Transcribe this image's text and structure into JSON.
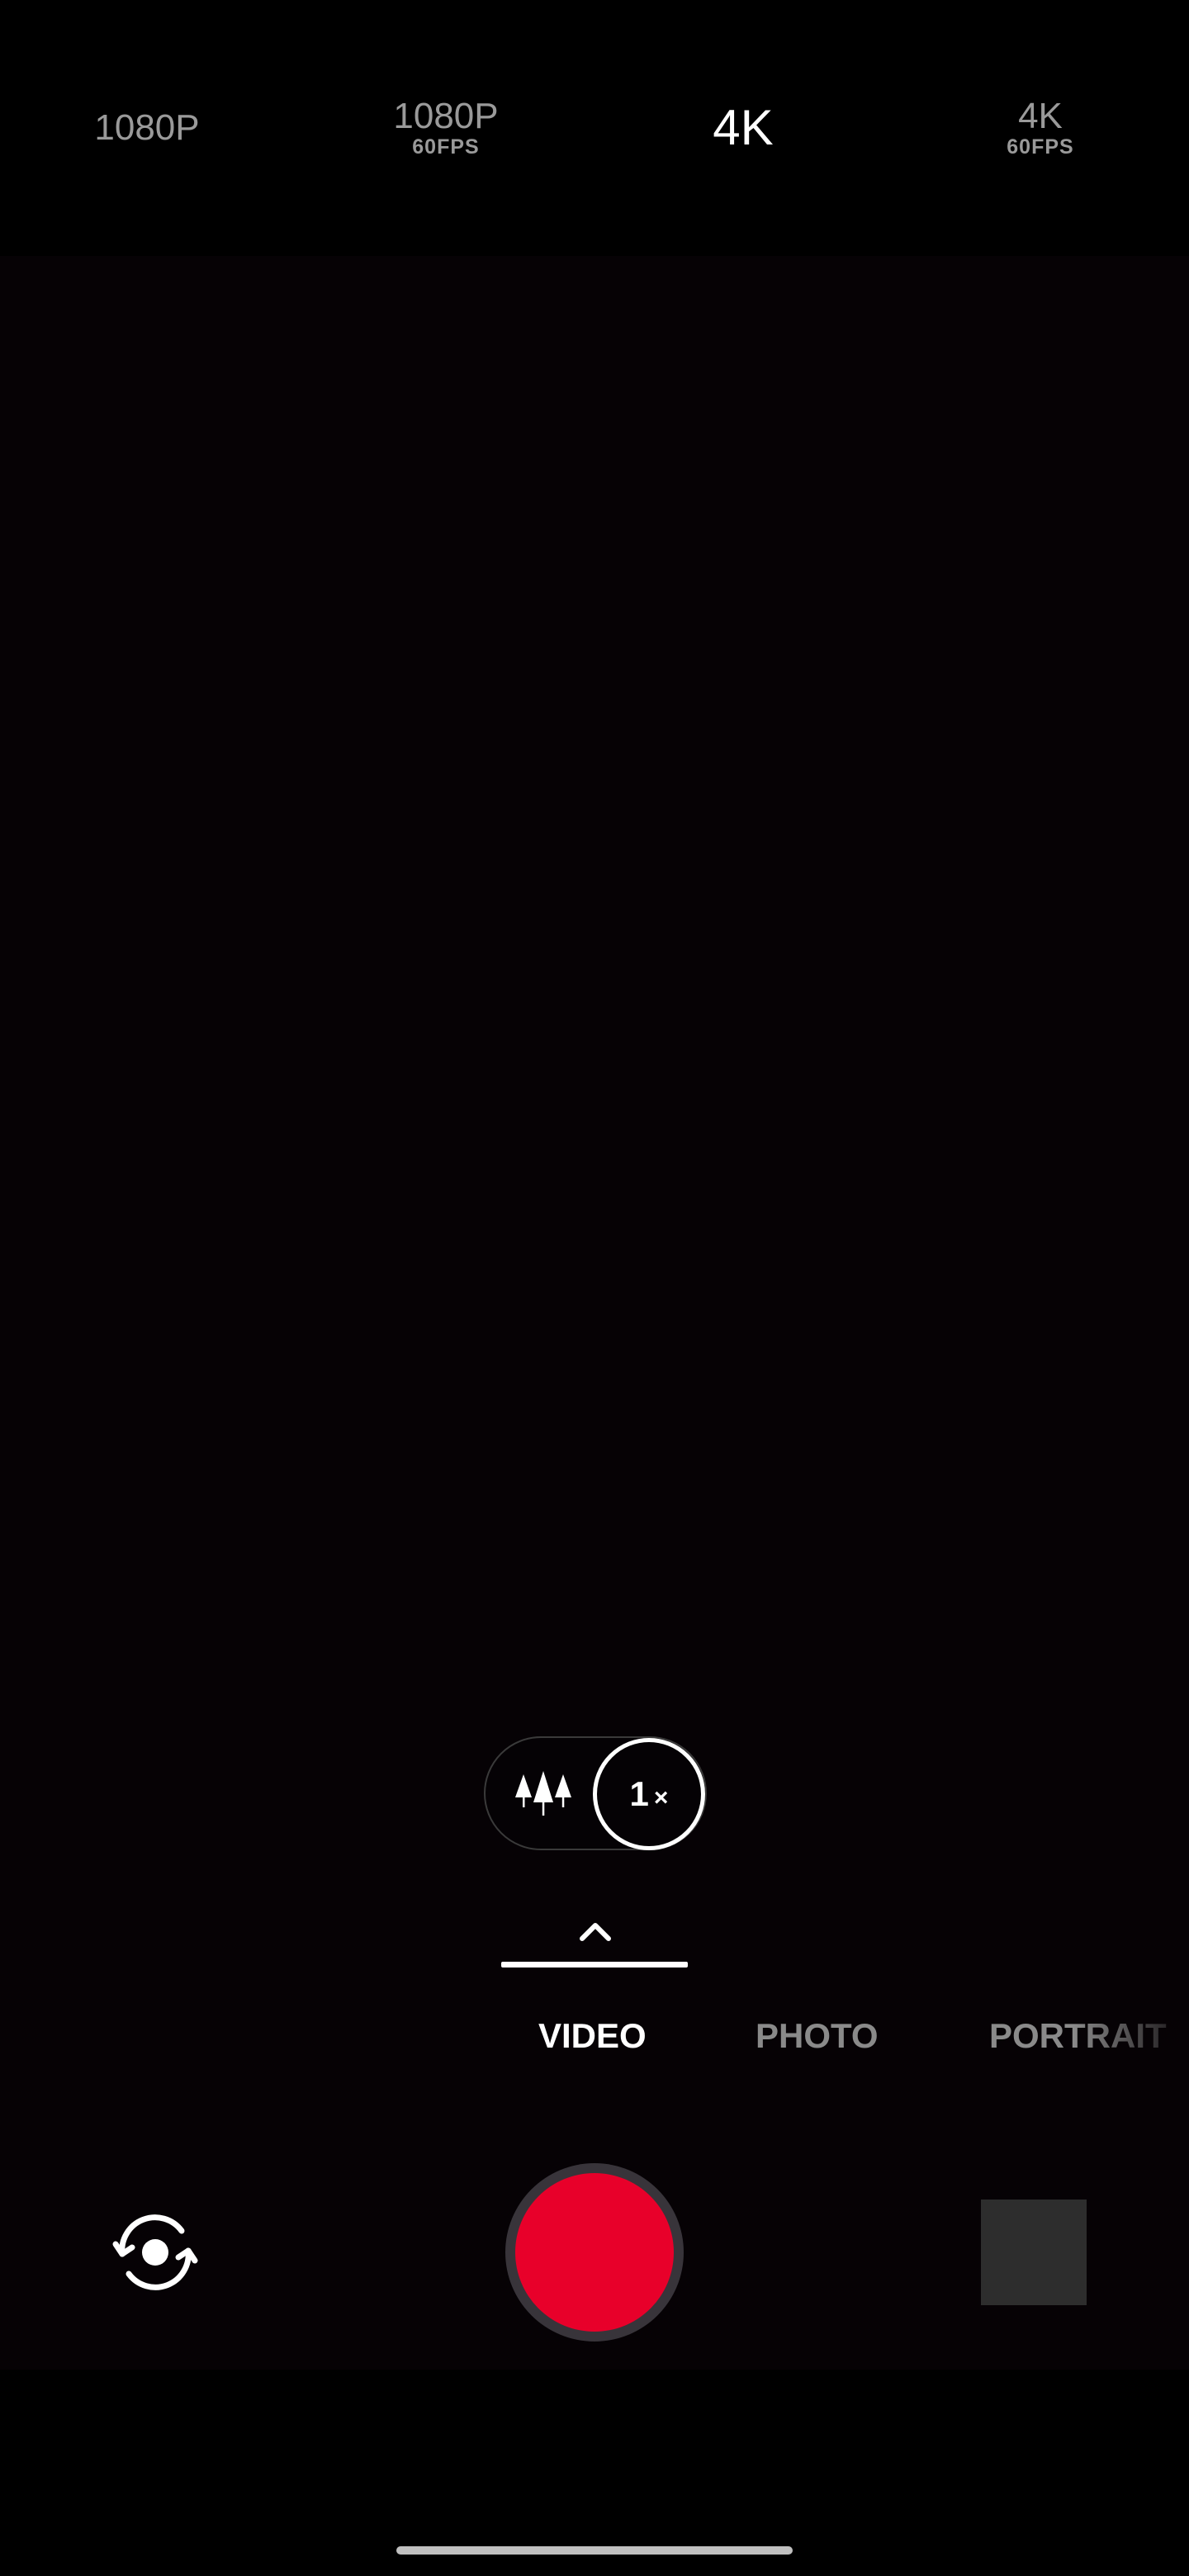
{
  "resolution_bar": {
    "options": [
      {
        "label": "1080P",
        "sub": ""
      },
      {
        "label": "1080P",
        "sub": "60FPS"
      },
      {
        "label": "4K",
        "sub": "",
        "active": true
      },
      {
        "label": "4K",
        "sub": "60FPS"
      }
    ]
  },
  "zoom": {
    "lens_icon": "trees-icon",
    "level_number": "1",
    "level_suffix": "×"
  },
  "mode_drawer": {
    "icon": "chevron-up-icon"
  },
  "modes": [
    {
      "label": "VIDEO",
      "active": true
    },
    {
      "label": "PHOTO"
    },
    {
      "label": "PORTRAIT"
    }
  ],
  "controls": {
    "flip_icon": "camera-switch-icon",
    "shutter_color": "#e8002a",
    "gallery_thumbnail": "gallery-thumbnail"
  },
  "colors": {
    "background": "#000000",
    "viewfinder": "#060205",
    "record_red": "#e8002a",
    "inactive_text": "#9a9a9a",
    "active_text": "#ffffff"
  }
}
